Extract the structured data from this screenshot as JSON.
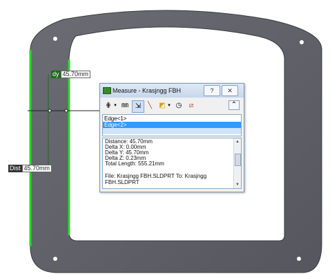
{
  "dimensions": {
    "vertical": {
      "tag": "dy",
      "value": "45.70mm"
    },
    "distance": {
      "tag": "Dist",
      "value": "45.70mm"
    }
  },
  "dialog": {
    "title": "Measure - Krasjngg FBH",
    "help_label": "?",
    "close_label": "✕",
    "collapse_label": "⌃",
    "selections": [
      "Edge<1>",
      "Edge<2>"
    ],
    "results": [
      "Distance: 45.70mm",
      "Delta X: 0.00mm",
      "Delta Y: 45.70mm",
      "Delta Z: 0.23mm",
      "Total Length: 555.21mm",
      "",
      "File: Krasjngg FBH.SLDPRT To: Krasjngg",
      "FBH.SLDPRT"
    ]
  },
  "colors": {
    "part_fill": "#5f6068",
    "selected_edge": "#22dd22",
    "selection_highlight": "#cfe4fb"
  }
}
